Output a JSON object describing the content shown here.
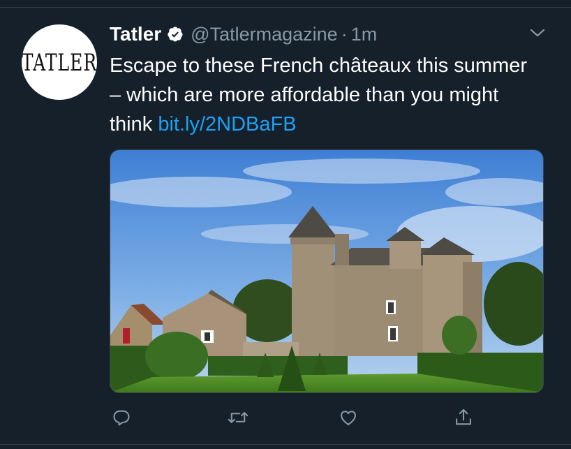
{
  "author": {
    "avatar_text": "TATLER",
    "name": "Tatler",
    "handle": "@Tatlermagazine",
    "separator": "·",
    "time": "1m"
  },
  "tweet": {
    "text": "Escape to these French châteaux this summer – which are more affordable than you might think ",
    "link": "bit.ly/2NDBaFB"
  },
  "icons": {
    "verified": "verified-badge-icon",
    "more": "chevron-down-icon",
    "reply": "reply-icon",
    "retweet": "retweet-icon",
    "like": "heart-icon",
    "share": "share-icon"
  },
  "colors": {
    "background": "#15202b",
    "link": "#1da1f2",
    "secondary_text": "#8899a6"
  }
}
